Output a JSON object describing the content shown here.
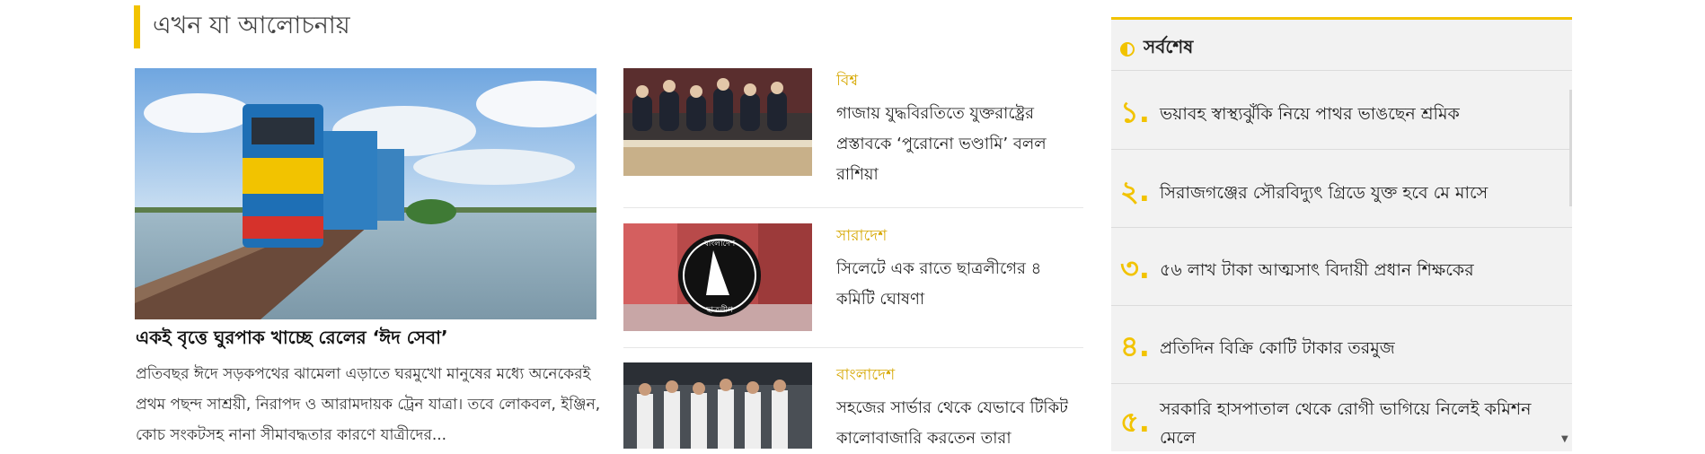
{
  "section": {
    "title": "এখন যা আলোচনায়",
    "accent_color": "#f2c300"
  },
  "lead_story": {
    "image_icon": "train-on-bridge-photo",
    "title": "একই বৃত্তে ঘুরপাক খাচ্ছে রেলের ‘ঈদ সেবা’",
    "summary": "প্রতিবছর ঈদে সড়কপথের ঝামেলা এড়াতে ঘরমুখো মানুষের মধ্যে অনেকেরই প্রথম পছন্দ সাশ্রয়ী, নিরাপদ ও আরামদায়ক ট্রেন যাত্রা। তবে লোকবল, ইঞ্জিন, কোচ সংকটসহ নানা সীমাবদ্ধতার কারণে যাত্রীদের..."
  },
  "stories": [
    {
      "category": "বিশ্ব",
      "headline": "গাজায় যুদ্ধবিরতিতে যুক্তরাষ্ট্রের প্রস্তাবকে ‘পুরোনো ভণ্ডামি’ বলল রাশিয়া",
      "image_icon": "council-meeting-photo"
    },
    {
      "category": "সারাদেশ",
      "headline": "সিলেটে এক রাতে ছাত্রলীগের ৪ কমিটি ঘোষণা",
      "image_icon": "emblem-photo",
      "emblem_text_top": "বাংলাদেশ",
      "emblem_text_bottom": "ছাত্রলীগ"
    },
    {
      "category": "বাংলাদেশ",
      "headline": "সহজের সার্ভার থেকে যেভাবে টিকিট কালোবাজারি করতেন তারা",
      "image_icon": "group-photo"
    }
  ],
  "latest": {
    "title": "সর্বশেষ",
    "icon": "half-circle-icon",
    "items": [
      {
        "num": "১.",
        "text": "ভয়াবহ স্বাস্থ্যঝুঁকি নিয়ে পাথর ভাঙছেন শ্রমিক"
      },
      {
        "num": "২.",
        "text": "সিরাজগঞ্জের সৌরবিদ্যুৎ গ্রিডে যুক্ত হবে মে মাসে"
      },
      {
        "num": "৩.",
        "text": "৫৬ লাখ টাকা আত্মসাৎ বিদায়ী প্রধান শিক্ষকের"
      },
      {
        "num": "৪.",
        "text": "প্রতিদিন বিক্রি কোটি টাকার তরমুজ"
      },
      {
        "num": "৫.",
        "text": "সরকারি হাসপাতাল থেকে রোগী ভাগিয়ে নিলেই কমিশন মেলে"
      }
    ]
  }
}
